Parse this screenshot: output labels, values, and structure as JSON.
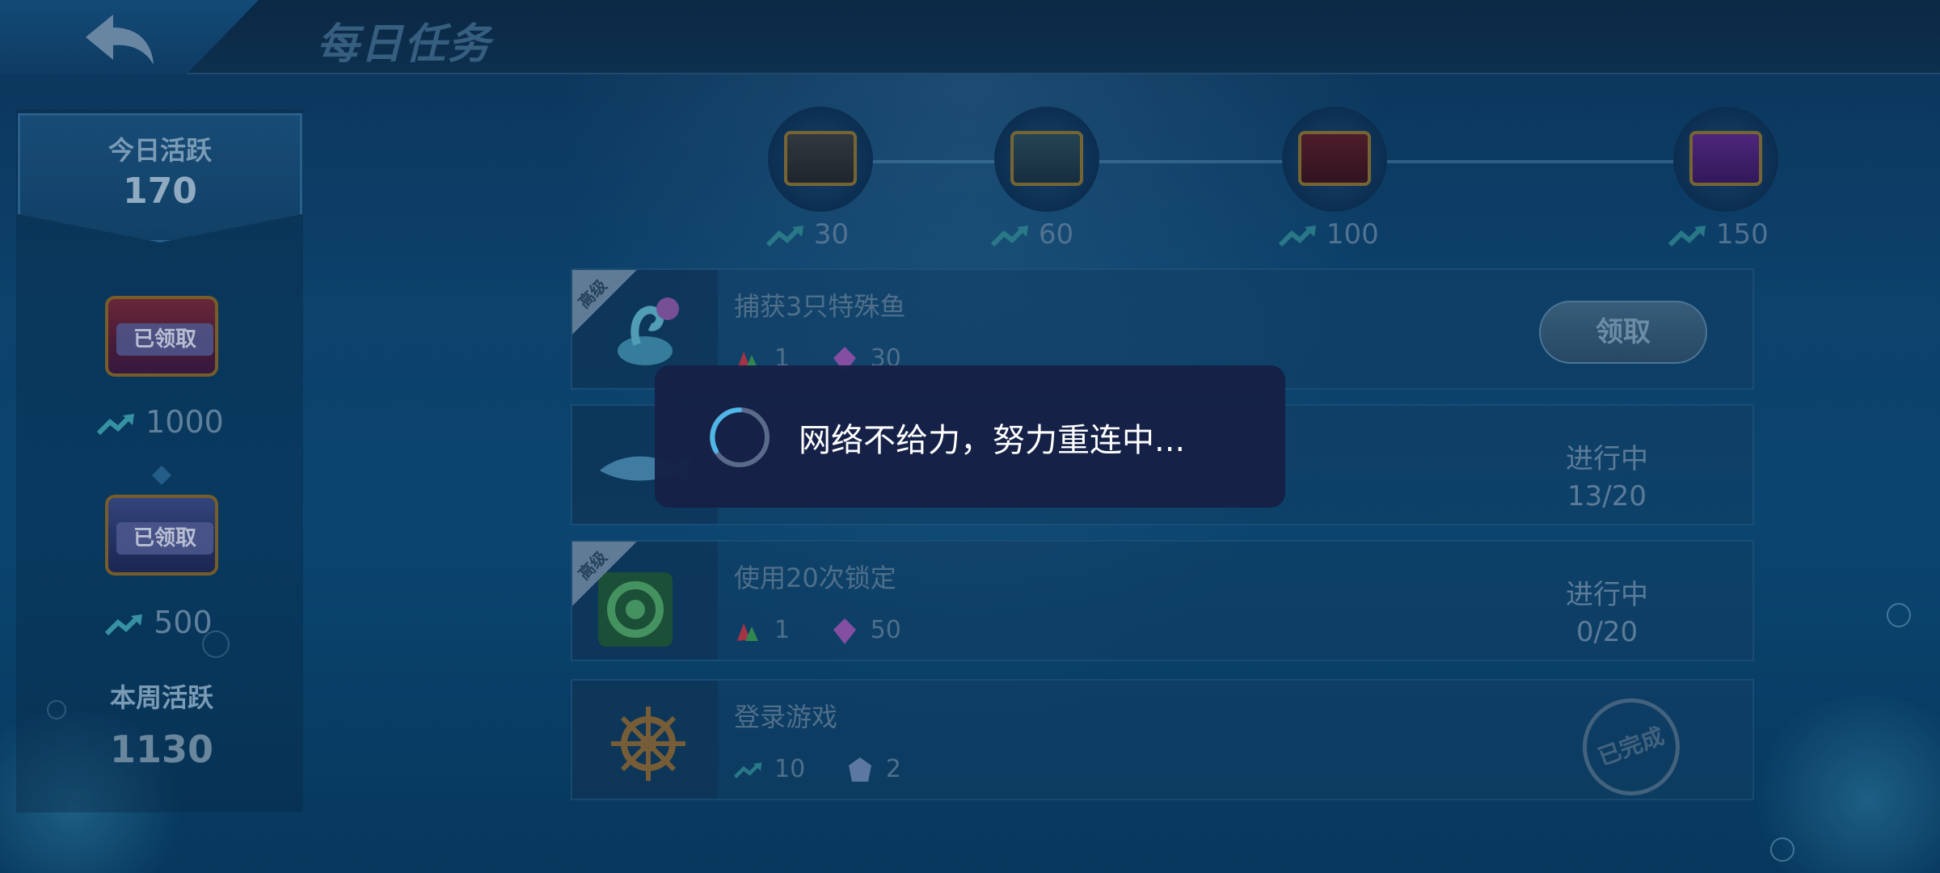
{
  "header": {
    "title": "每日任务"
  },
  "sidebar": {
    "today_label": "今日活跃",
    "today_value": "170",
    "rewards": [
      {
        "claimed_label": "已领取",
        "amount": "1000",
        "chest": "red"
      },
      {
        "claimed_label": "已领取",
        "amount": "500",
        "chest": "blue"
      }
    ],
    "week_label": "本周活跃",
    "week_value": "1130"
  },
  "milestones": [
    {
      "value": "30",
      "chest": "gray"
    },
    {
      "value": "60",
      "chest": "green"
    },
    {
      "value": "100",
      "chest": "red"
    },
    {
      "value": "150",
      "chest": "purple"
    }
  ],
  "tasks": [
    {
      "advanced_label": "高级",
      "title": "捕获3只特殊鱼",
      "reward_1": "1",
      "reward_2": "30",
      "action_label": "领取",
      "icon": "seahorse-icon"
    },
    {
      "status": "进行中",
      "progress": "13/20",
      "icon": "fish-icon"
    },
    {
      "advanced_label": "高级",
      "title": "使用20次锁定",
      "reward_1": "1",
      "reward_2": "50",
      "status": "进行中",
      "progress": "0/20",
      "icon": "lock-target-icon"
    },
    {
      "title": "登录游戏",
      "reward_1": "10",
      "reward_2": "2",
      "stamp": "已完成",
      "icon": "ship-wheel-icon"
    }
  ],
  "toast": {
    "message": "网络不给力，努力重连中..."
  },
  "colors": {
    "background": "#0d4a78",
    "toast_bg": "#16204a",
    "spinner_accent": "#4fb6e8"
  }
}
